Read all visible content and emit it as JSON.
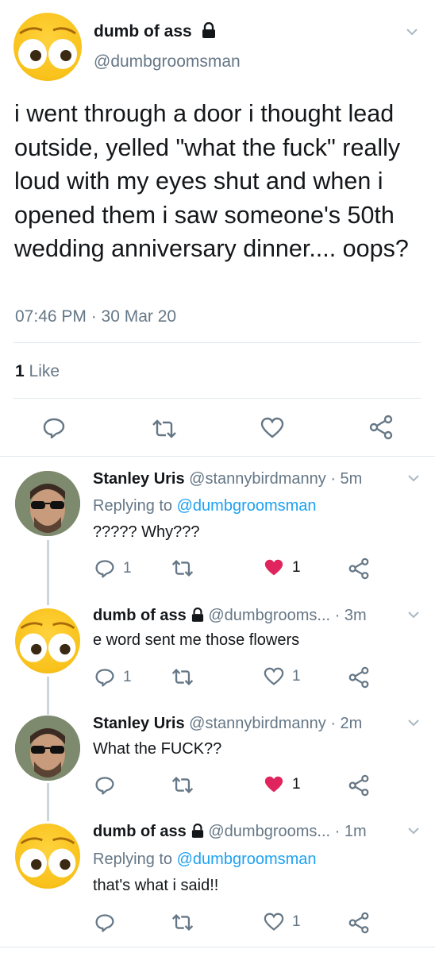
{
  "main_tweet": {
    "display_name": "dumb of ass",
    "handle": "@dumbgroomsman",
    "text": "i went through a door i thought lead outside, yelled \"what the fuck\" really loud with my eyes shut and when i opened them i saw someone's 50th wedding anniversary dinner.... oops?",
    "timestamp": "07:46 PM · 30 Mar 20",
    "likes_count": "1",
    "likes_label": "Like"
  },
  "replies": [
    {
      "name": "Stanley Uris",
      "handle": "@stannybirdmanny",
      "time": "· 5m",
      "replying_prefix": "Replying to",
      "replying_to": "@dumbgroomsman",
      "text": "????? Why???",
      "reply_count": "1",
      "like_count": "1",
      "liked": true
    },
    {
      "name": "dumb of ass",
      "handle": "@dumbgrooms...",
      "time": "· 3m",
      "text": "e word sent me those flowers",
      "reply_count": "1",
      "like_count": "1",
      "liked": false
    },
    {
      "name": "Stanley Uris",
      "handle": "@stannybirdmanny",
      "time": "· 2m",
      "text": "What the FUCK??",
      "reply_count": "",
      "like_count": "1",
      "liked": true
    },
    {
      "name": "dumb of ass",
      "handle": "@dumbgrooms...",
      "time": "· 1m",
      "replying_prefix": "Replying to",
      "replying_to": "@dumbgroomsman",
      "text": "that's what i said!!",
      "reply_count": "",
      "like_count": "1",
      "liked": false
    }
  ],
  "colors": {
    "accent": "#1da1f2",
    "like": "#e0245e",
    "muted": "#657786",
    "divider": "#e1e8ed"
  }
}
